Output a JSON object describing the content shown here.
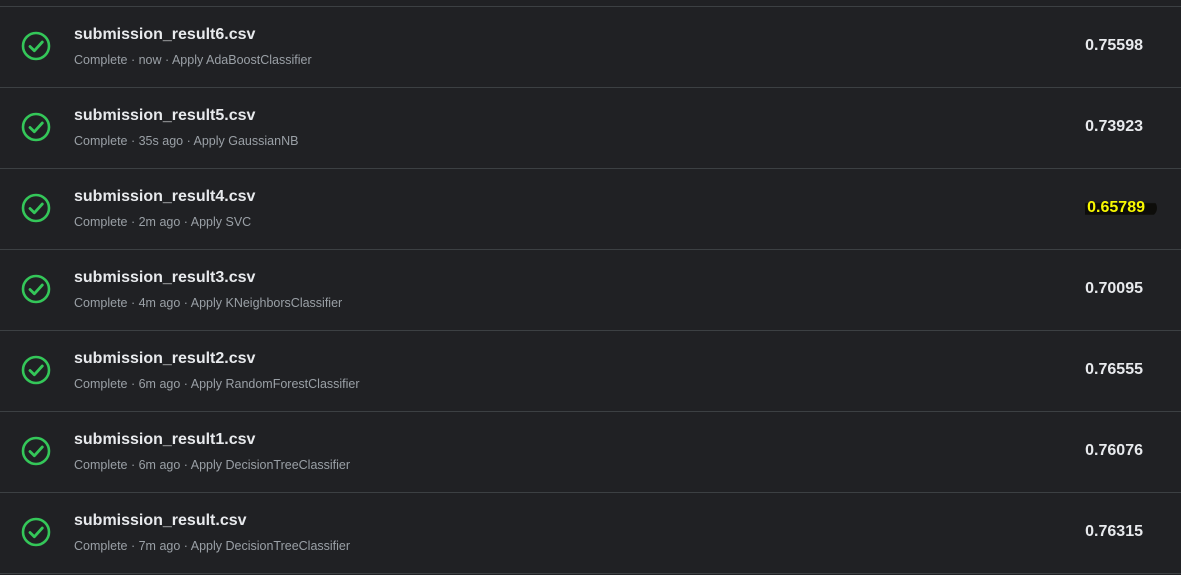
{
  "submissions": [
    {
      "file": "submission_result6.csv",
      "status": "Complete",
      "time": "now",
      "description": "Apply AdaBoostClassifier",
      "score": "0.75598",
      "highlight": false
    },
    {
      "file": "submission_result5.csv",
      "status": "Complete",
      "time": "35s ago",
      "description": "Apply GaussianNB",
      "score": "0.73923",
      "highlight": false
    },
    {
      "file": "submission_result4.csv",
      "status": "Complete",
      "time": "2m ago",
      "description": "Apply SVC",
      "score": "0.65789",
      "highlight": true
    },
    {
      "file": "submission_result3.csv",
      "status": "Complete",
      "time": "4m ago",
      "description": "Apply KNeighborsClassifier",
      "score": "0.70095",
      "highlight": false
    },
    {
      "file": "submission_result2.csv",
      "status": "Complete",
      "time": "6m ago",
      "description": "Apply RandomForestClassifier",
      "score": "0.76555",
      "highlight": false
    },
    {
      "file": "submission_result1.csv",
      "status": "Complete",
      "time": "6m ago",
      "description": "Apply DecisionTreeClassifier",
      "score": "0.76076",
      "highlight": false
    },
    {
      "file": "submission_result.csv",
      "status": "Complete",
      "time": "7m ago",
      "description": "Apply DecisionTreeClassifier",
      "score": "0.76315",
      "highlight": false
    }
  ],
  "meta_separator": " · ",
  "colors": {
    "background": "#202124",
    "check": "#34c759",
    "highlight_text": "#f9f900",
    "primary_text": "#e8eaed",
    "secondary_text": "#9aa0a6",
    "divider": "#3c4043"
  },
  "icon": "check-circle-icon"
}
